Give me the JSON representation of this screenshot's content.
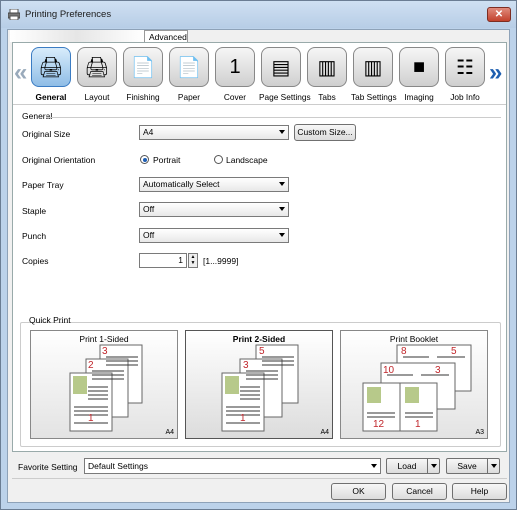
{
  "window": {
    "title": "Printing Preferences",
    "close_label": "✕"
  },
  "tabs": {
    "blank": "",
    "advanced": "Advanced"
  },
  "features": [
    {
      "label": "General",
      "icon": "general-icon",
      "glyph": "🖨"
    },
    {
      "label": "Layout",
      "icon": "layout-icon",
      "glyph": "🖨"
    },
    {
      "label": "Finishing",
      "icon": "finishing-icon",
      "glyph": "📄"
    },
    {
      "label": "Paper",
      "icon": "paper-icon",
      "glyph": "📄"
    },
    {
      "label": "Cover",
      "icon": "cover-icon",
      "glyph": "1"
    },
    {
      "label": "Page Settings",
      "icon": "page-settings-icon",
      "glyph": "▤"
    },
    {
      "label": "Tabs",
      "icon": "tabs-icon",
      "glyph": "▥"
    },
    {
      "label": "Tab Settings",
      "icon": "tab-settings-icon",
      "glyph": "▥"
    },
    {
      "label": "Imaging",
      "icon": "imaging-icon",
      "glyph": "■"
    },
    {
      "label": "Job Info",
      "icon": "job-info-icon",
      "glyph": "☷"
    }
  ],
  "general": {
    "section_title": "General",
    "original_size": {
      "label": "Original Size",
      "value": "A4",
      "button": "Custom Size..."
    },
    "orientation": {
      "label": "Original Orientation",
      "portrait": "Portrait",
      "landscape": "Landscape",
      "selected": "Portrait"
    },
    "paper_tray": {
      "label": "Paper Tray",
      "value": "Automatically Select"
    },
    "staple": {
      "label": "Staple",
      "value": "Off"
    },
    "punch": {
      "label": "Punch",
      "value": "Off"
    },
    "copies": {
      "label": "Copies",
      "value": "1",
      "range": "[1...9999]"
    }
  },
  "quick_print": {
    "title": "Quick Print",
    "cards": [
      {
        "label": "Print 1-Sided",
        "size": "A4",
        "selected": false
      },
      {
        "label": "Print 2-Sided",
        "size": "A4",
        "selected": true
      },
      {
        "label": "Print Booklet",
        "size": "A3",
        "selected": false
      }
    ]
  },
  "favorite": {
    "label": "Favorite Setting",
    "value": "Default Settings",
    "load": "Load",
    "save": "Save"
  },
  "footer": {
    "ok": "OK",
    "cancel": "Cancel",
    "help": "Help"
  },
  "colors": {
    "selected_icon_bg": "#8fbde6",
    "accent": "#1e5fb0",
    "page_numbers": "#c0262b",
    "paper_art": "#6f8f3e"
  }
}
